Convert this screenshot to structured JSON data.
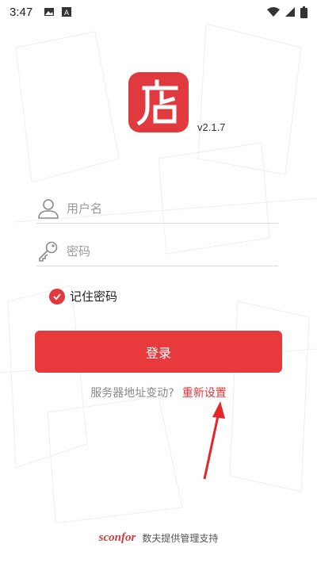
{
  "status_bar": {
    "time": "3:47",
    "icons_left": [
      "image-icon",
      "a-badge-icon"
    ],
    "icons_right": [
      "wifi-icon",
      "signal-icon",
      "battery-icon"
    ]
  },
  "app": {
    "logo_icon": "store-logo-icon",
    "version": "v2.1.7"
  },
  "login_form": {
    "username_placeholder": "用户名",
    "username_value": "",
    "password_placeholder": "密码",
    "password_value": "",
    "remember_label": "记住密码",
    "remember_checked": true,
    "login_button": "登录"
  },
  "server": {
    "question": "服务器地址变动?",
    "reset_link": "重新设置"
  },
  "footer": {
    "brand": "sconfor",
    "text": "数夫提供管理支持"
  },
  "colors": {
    "brand_red": "#e03a3e",
    "button_red": "#e8393d",
    "placeholder_gray": "#9a9a9a"
  }
}
